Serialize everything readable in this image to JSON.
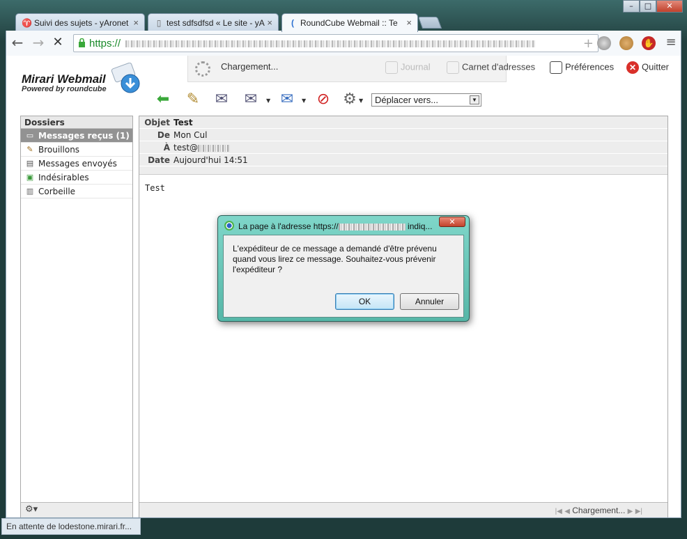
{
  "browser": {
    "tabs": [
      {
        "title": "Suivi des sujets - yAronet",
        "icon": "y-icon"
      },
      {
        "title": "test sdfsdfsd « Le site - yA",
        "icon": "page-icon"
      },
      {
        "title": "RoundCube Webmail :: Te",
        "icon": "loading-icon"
      }
    ],
    "close_glyph": "×",
    "window_controls": {
      "minimize": "–",
      "maximize": "□",
      "close": "✕"
    },
    "url_scheme": "https://",
    "status_text": "En attente de lodestone.mirari.fr..."
  },
  "app": {
    "logo_title": "Mirari Webmail",
    "logo_sub": "Powered by roundcube",
    "loading_text": "Chargement...",
    "topnav": {
      "journal": "Journal",
      "contacts": "Carnet d'adresses",
      "preferences": "Préférences",
      "quit": "Quitter"
    },
    "move_to": "Déplacer vers...",
    "folders_title": "Dossiers",
    "folders": [
      {
        "label": "Messages reçus (1)",
        "icon": "inbox-icon",
        "selected": true
      },
      {
        "label": "Brouillons",
        "icon": "pencil-icon",
        "selected": false
      },
      {
        "label": "Messages envoyés",
        "icon": "sent-icon",
        "selected": false
      },
      {
        "label": "Indésirables",
        "icon": "junk-icon",
        "selected": false
      },
      {
        "label": "Corbeille",
        "icon": "trash-icon",
        "selected": false
      }
    ],
    "message": {
      "subject_label": "Objet",
      "subject": "Test",
      "from_label": "De",
      "from": "Mon Cul",
      "to_label": "À",
      "to": "test@",
      "date_label": "Date",
      "date": "Aujourd'hui 14:51",
      "body": "Test",
      "footer_loading": "Chargement..."
    }
  },
  "dialog": {
    "title_prefix": "La page à l'adresse https://",
    "title_suffix": " indiq...",
    "message": "L'expéditeur de ce message a demandé d'être prévenu quand vous lirez ce message. Souhaitez-vous prévenir l'expéditeur ?",
    "ok": "OK",
    "cancel": "Annuler"
  }
}
